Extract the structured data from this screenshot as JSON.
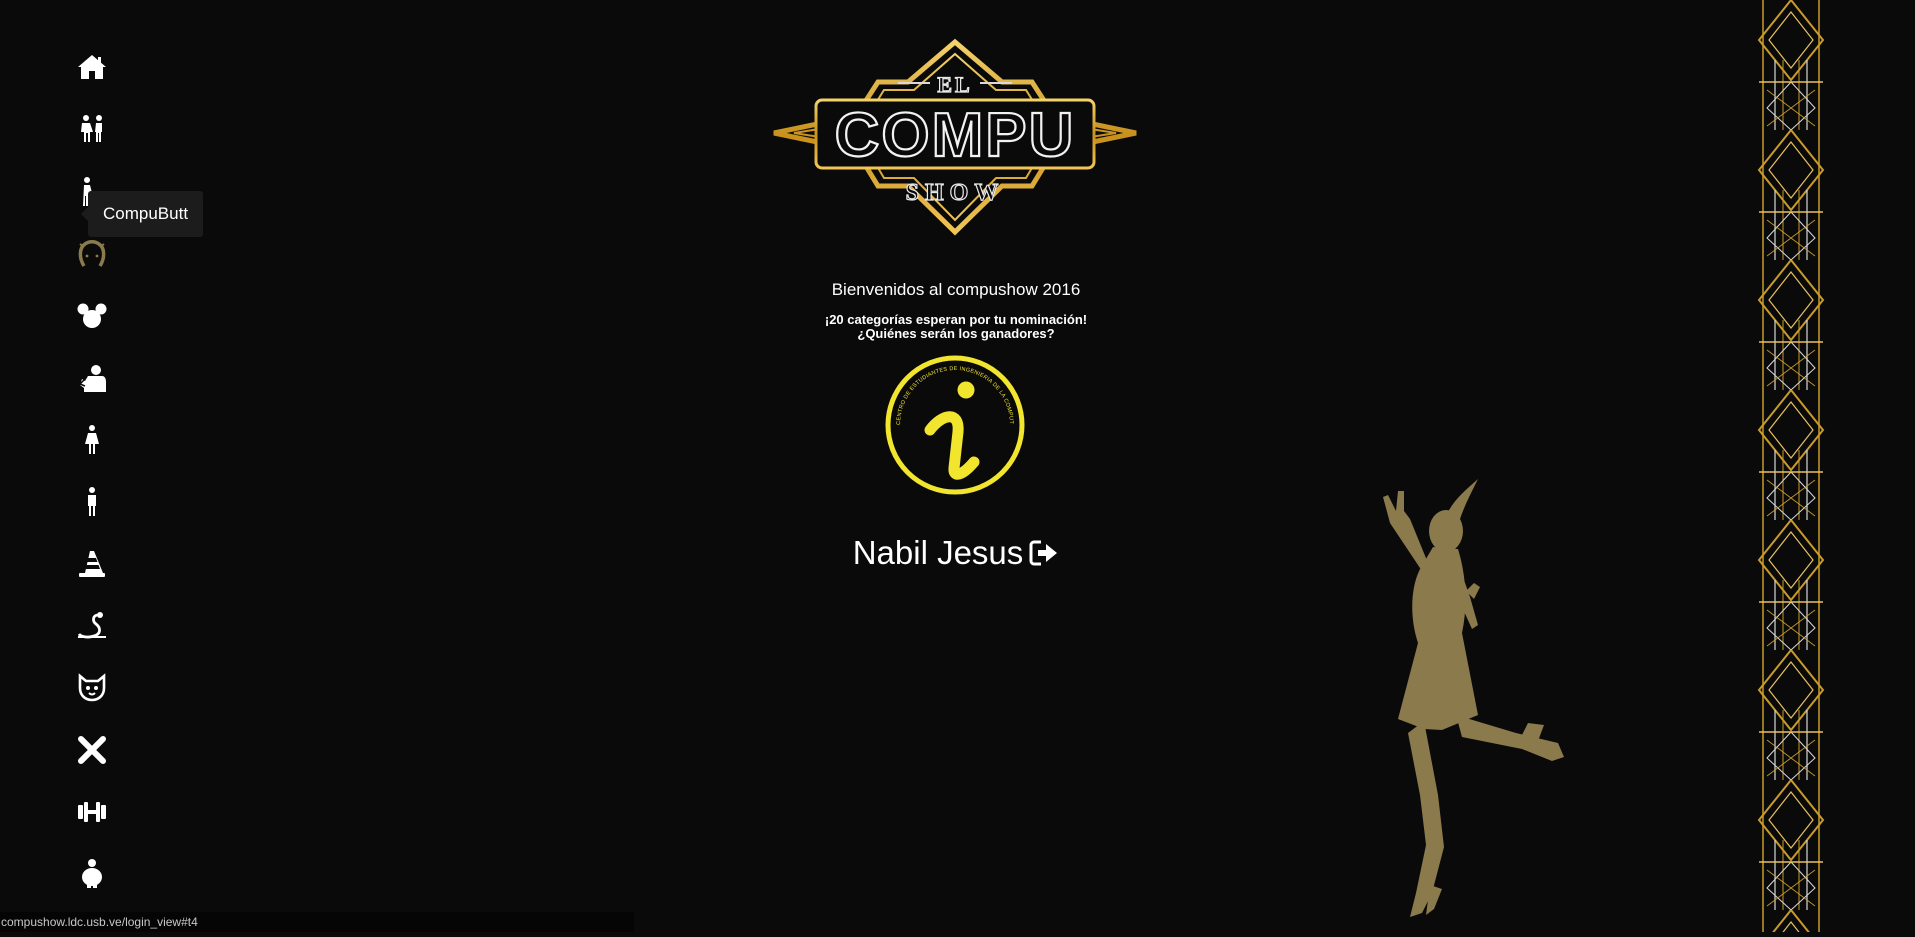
{
  "sidebar": {
    "items": [
      {
        "icon": "home-icon"
      },
      {
        "icon": "couple-icon"
      },
      {
        "icon": "compubutt-icon"
      },
      {
        "icon": "horseshoe-icon",
        "active": true
      },
      {
        "icon": "mickey-icon"
      },
      {
        "icon": "thinking-person-icon"
      },
      {
        "icon": "woman-icon"
      },
      {
        "icon": "man-icon"
      },
      {
        "icon": "traffic-cone-icon"
      },
      {
        "icon": "snake-icon"
      },
      {
        "icon": "cat-icon"
      },
      {
        "icon": "close-x-icon"
      },
      {
        "icon": "dumbbell-icon"
      },
      {
        "icon": "chubby-person-icon"
      }
    ],
    "tooltip": "CompuButt"
  },
  "logo": {
    "top": "EL",
    "main": "COMPU",
    "bottom": "SHOW"
  },
  "welcome": "Bienvenidos al compushow 2016",
  "sub1": "¡20 categorías esperan por tu nominación!",
  "sub2": "¿Quiénes serán los ganadores?",
  "info_logo": {
    "ring_text": "CENTRO DE ESTUDIANTES DE INGENIERIA DE LA COMPUTACION"
  },
  "user": {
    "name": "Nabil Jesus",
    "logout_icon": "sign-out-icon"
  },
  "status_url": "compushow.ldc.usb.ve/login_view#t4",
  "colors": {
    "background": "#0a0a0a",
    "gold": "#c89b2a",
    "silhouette": "#8a7a4c",
    "info_yellow": "#f2e52e",
    "tooltip_bg": "#1c1c1c"
  }
}
